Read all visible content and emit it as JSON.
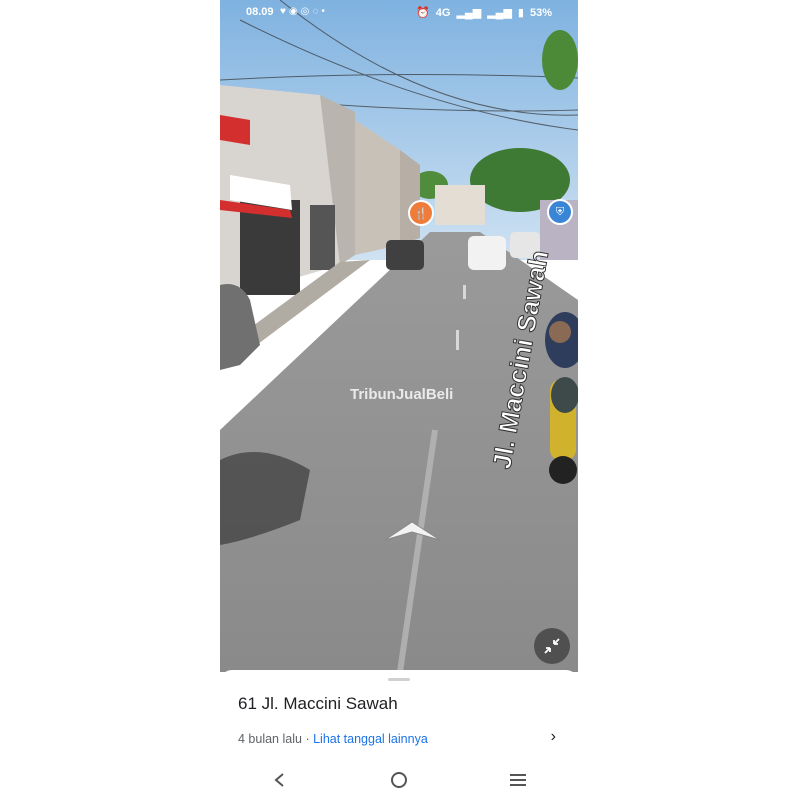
{
  "status_bar": {
    "time": "08.09",
    "network": "4G",
    "battery": "53%",
    "left_icons": [
      "heart-icon",
      "chat-icon",
      "instagram-icon",
      "ring-icon",
      "dot-icon"
    ],
    "right_icons": [
      "alarm-icon",
      "signal-icon",
      "signal-icon-2",
      "battery-icon"
    ]
  },
  "street_view": {
    "street_label": "Jl. Maccini Sawah",
    "watermark": "TribunJualBeli",
    "poi_pins": [
      {
        "name": "restaurant-pin",
        "icon": "fork-knife-icon",
        "color": "#f07c3a"
      },
      {
        "name": "shopping-pin",
        "icon": "shopping-bag-icon",
        "color": "#3a86d6"
      }
    ],
    "minimize_icon": "minimize-icon"
  },
  "bottom_sheet": {
    "address": "61 Jl. Maccini Sawah",
    "age": "4 bulan lalu",
    "separator": "·",
    "link": "Lihat tanggal lainnya",
    "chevron_icon": "chevron-right-icon"
  },
  "nav_bar": {
    "icons": [
      "back-icon",
      "home-icon",
      "recents-icon"
    ]
  },
  "colors": {
    "sky": "#a9cdee",
    "road": "#8d8d8d",
    "accent_link": "#1a73e8"
  }
}
